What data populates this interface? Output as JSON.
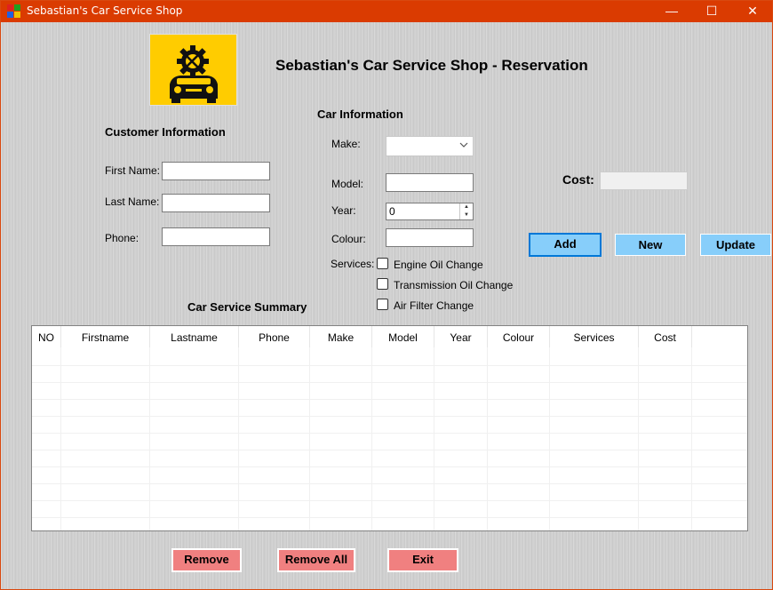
{
  "window": {
    "title": "Sebastian's Car Service Shop",
    "minimize_glyph": "—",
    "maximize_glyph": "☐",
    "close_glyph": "✕"
  },
  "header": {
    "title": "Sebastian's Car Service Shop - Reservation",
    "logo_icon": "car-service-gear-wrench-icon",
    "logo_color": "#ffcc00"
  },
  "customer": {
    "section_title": "Customer Information",
    "first_name_label": "First Name:",
    "first_name_value": "",
    "last_name_label": "Last Name:",
    "last_name_value": "",
    "phone_label": "Phone:",
    "phone_value": ""
  },
  "car": {
    "section_title": "Car Information",
    "make_label": "Make:",
    "make_value": "",
    "model_label": "Model:",
    "model_value": "",
    "year_label": "Year:",
    "year_value": "0",
    "colour_label": "Colour:",
    "colour_value": "",
    "services_label": "Services:",
    "services": [
      {
        "label": "Engine Oil Change",
        "checked": false
      },
      {
        "label": "Transmission Oil Change",
        "checked": false
      },
      {
        "label": "Air Filter Change",
        "checked": false
      }
    ]
  },
  "cost": {
    "label": "Cost:",
    "value": ""
  },
  "actions": {
    "add": "Add",
    "new": "New",
    "update": "Update",
    "remove": "Remove",
    "remove_all": "Remove All",
    "exit": "Exit"
  },
  "summary": {
    "title": "Car Service Summary",
    "columns": [
      "NO",
      "Firstname",
      "Lastname",
      "Phone",
      "Make",
      "Model",
      "Year",
      "Colour",
      "Services",
      "Cost"
    ],
    "rows": []
  },
  "colors": {
    "titlebar": "#da3b01",
    "blue_button": "#87cefa",
    "red_button": "#f08080"
  }
}
